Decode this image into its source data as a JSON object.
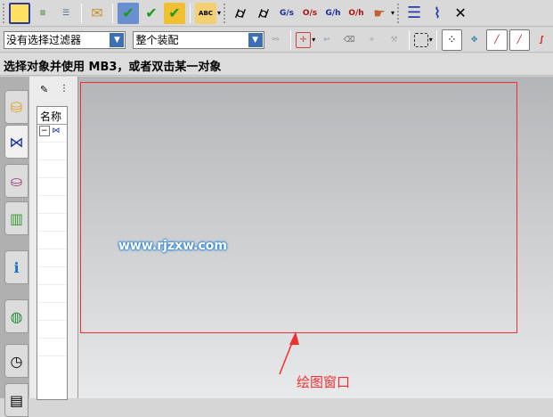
{
  "toolbar1": {
    "icons": [
      "csys-icon",
      "layers-icon",
      "layer-settings-icon",
      "tag-icon",
      "assembly-check-icon",
      "assembly-edit-icon",
      "assembly-replace-icon",
      "text-abc-icon",
      "analysis-icon",
      "analysis-2-icon",
      "gs-icon",
      "os-icon",
      "gh-icon",
      "oh-icon",
      "pointer-icon",
      "spring-stack-icon",
      "spring-icon",
      "close-tool-icon"
    ],
    "labels": {
      "gs": "G/s",
      "os": "O/s",
      "gh": "G/h",
      "oh": "O/h",
      "abc": "ABC"
    }
  },
  "toolbar2": {
    "filter_value": "没有选择过滤器",
    "scope_value": "整个装配"
  },
  "status": {
    "text": "选择对象并使用 MB3，或者双击某一对象"
  },
  "navigator": {
    "column_header": "名称",
    "tree_toggle": "−"
  },
  "graphics": {
    "watermark": "www.rjzxw.com",
    "annotation_label": "绘图窗口",
    "annotation_color": "#f03030"
  }
}
